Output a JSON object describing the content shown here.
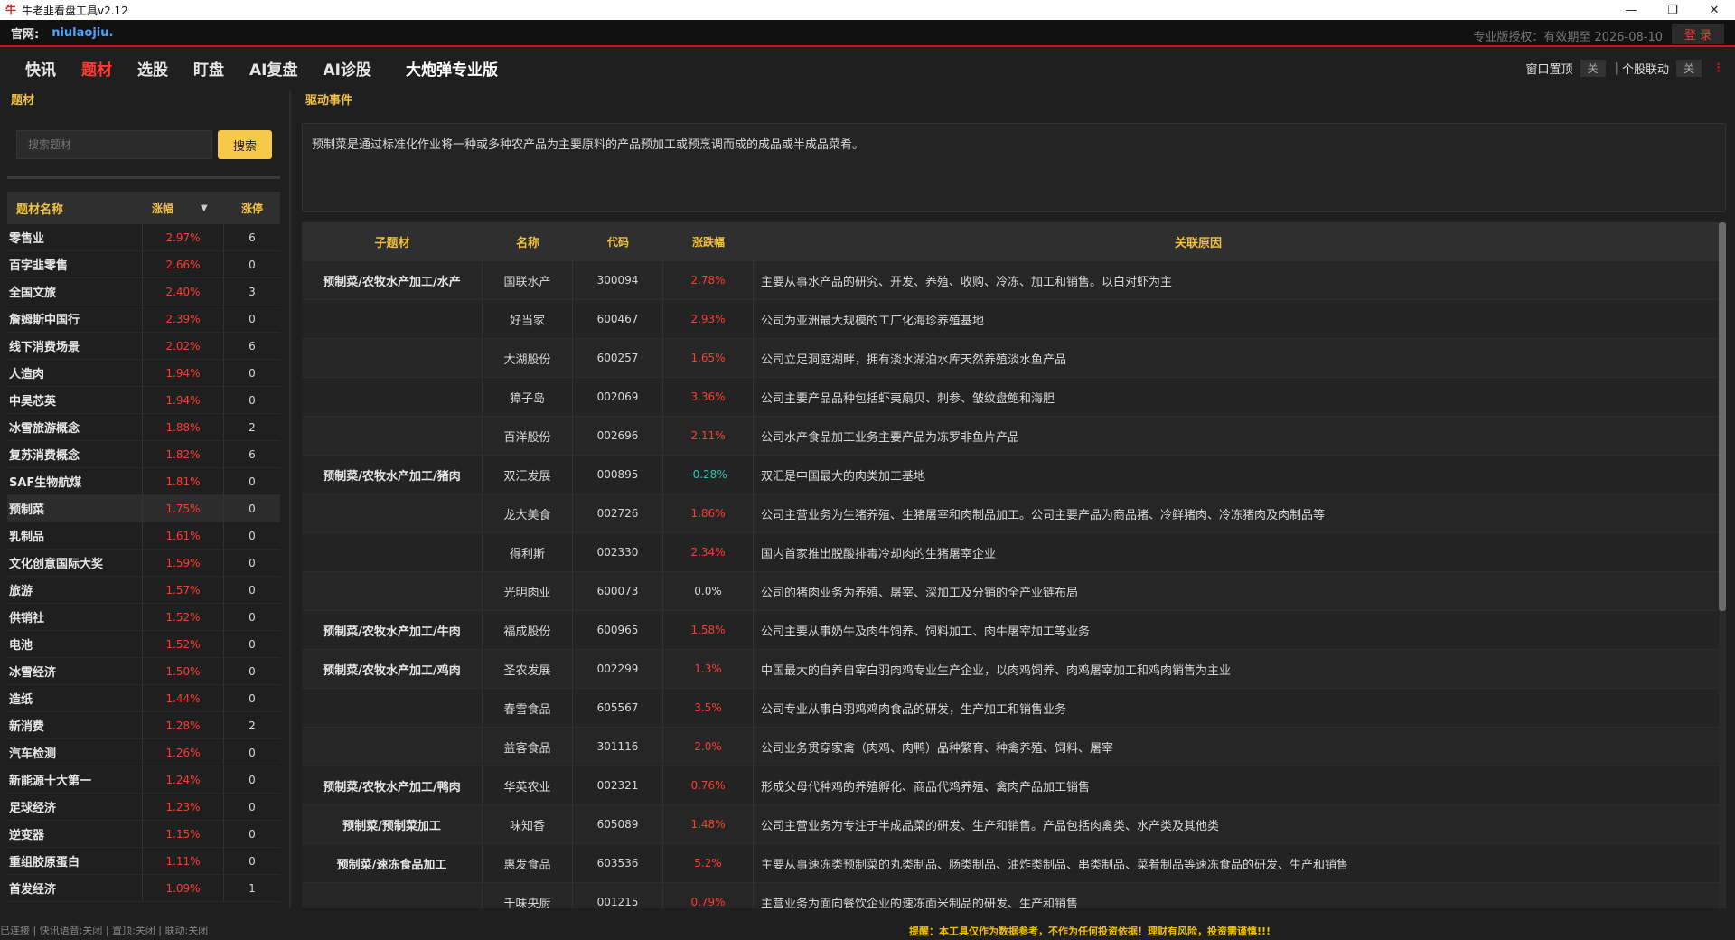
{
  "window": {
    "title": "牛老韭看盘工具v2.12",
    "logo_char": "牛",
    "minimize_label": "—",
    "restore_label": "❐",
    "close_label": "✕"
  },
  "site": {
    "label": "官网:",
    "link": "niulaojiu.",
    "license": "专业版授权：有效期至 2026-08-10",
    "login": "登 录"
  },
  "nav": {
    "items": [
      "快讯",
      "题材",
      "选股",
      "盯盘",
      "AI复盘",
      "AI诊股",
      "大炮弹专业版"
    ],
    "active": "题材",
    "right": {
      "pin_label": "窗口置顶",
      "pin_state": "关",
      "sep": "|",
      "link_label": "个股联动",
      "link_state": "关",
      "more_icon": "⋮"
    }
  },
  "left": {
    "title": "题材",
    "search_placeholder": "搜索题材",
    "search_button": "搜索",
    "headers": {
      "name": "题材名称",
      "change": "涨幅",
      "sort_icon": "▼",
      "limit": "涨停"
    },
    "rows": [
      {
        "name": "零售业",
        "change": "2.97%",
        "limit": "6"
      },
      {
        "name": "百字韭零售",
        "change": "2.66%",
        "limit": "0"
      },
      {
        "name": "全国文旅",
        "change": "2.40%",
        "limit": "3"
      },
      {
        "name": "詹姆斯中国行",
        "change": "2.39%",
        "limit": "0"
      },
      {
        "name": "线下消费场景",
        "change": "2.02%",
        "limit": "6"
      },
      {
        "name": "人造肉",
        "change": "1.94%",
        "limit": "0"
      },
      {
        "name": "中昊芯英",
        "change": "1.94%",
        "limit": "0"
      },
      {
        "name": "冰雪旅游概念",
        "change": "1.88%",
        "limit": "2"
      },
      {
        "name": "复苏消费概念",
        "change": "1.82%",
        "limit": "6"
      },
      {
        "name": "SAF生物航煤",
        "change": "1.81%",
        "limit": "0"
      },
      {
        "name": "预制菜",
        "change": "1.75%",
        "limit": "0"
      },
      {
        "name": "乳制品",
        "change": "1.61%",
        "limit": "0"
      },
      {
        "name": "文化创意国际大奖",
        "change": "1.59%",
        "limit": "0"
      },
      {
        "name": "旅游",
        "change": "1.57%",
        "limit": "0"
      },
      {
        "name": "供销社",
        "change": "1.52%",
        "limit": "0"
      },
      {
        "name": "电池",
        "change": "1.52%",
        "limit": "0"
      },
      {
        "name": "冰雪经济",
        "change": "1.50%",
        "limit": "0"
      },
      {
        "name": "造纸",
        "change": "1.44%",
        "limit": "0"
      },
      {
        "name": "新消费",
        "change": "1.28%",
        "limit": "2"
      },
      {
        "name": "汽车检测",
        "change": "1.26%",
        "limit": "0"
      },
      {
        "name": "新能源十大第一",
        "change": "1.24%",
        "limit": "0"
      },
      {
        "name": "足球经济",
        "change": "1.23%",
        "limit": "0"
      },
      {
        "name": "逆变器",
        "change": "1.15%",
        "limit": "0"
      },
      {
        "name": "重组胶原蛋白",
        "change": "1.11%",
        "limit": "0"
      },
      {
        "name": "首发经济",
        "change": "1.09%",
        "limit": "1"
      }
    ],
    "selected": "预制菜"
  },
  "right": {
    "title": "驱动事件",
    "description": "预制菜是通过标准化作业将一种或多种农产品为主要原料的产品预加工或预烹调而成的成品或半成品菜肴。",
    "headers": {
      "sub": "子题材",
      "name": "名称",
      "code": "代码",
      "change": "涨跌幅",
      "reason": "关联原因"
    },
    "rows": [
      {
        "sub": "预制菜/农牧水产加工/水产",
        "name": "国联水产",
        "code": "300094",
        "change": "2.78%",
        "reason": "主要从事水产品的研究、开发、养殖、收购、冷冻、加工和销售。以白对虾为主"
      },
      {
        "sub": "",
        "name": "好当家",
        "code": "600467",
        "change": "2.93%",
        "reason": "公司为亚洲最大规模的工厂化海珍养殖基地"
      },
      {
        "sub": "",
        "name": "大湖股份",
        "code": "600257",
        "change": "1.65%",
        "reason": "公司立足洞庭湖畔，拥有淡水湖泊水库天然养殖淡水鱼产品"
      },
      {
        "sub": "",
        "name": "獐子岛",
        "code": "002069",
        "change": "3.36%",
        "reason": "公司主要产品品种包括虾夷扇贝、刺参、皱纹盘鲍和海胆"
      },
      {
        "sub": "",
        "name": "百洋股份",
        "code": "002696",
        "change": "2.11%",
        "reason": "公司水产食品加工业务主要产品为冻罗非鱼片产品"
      },
      {
        "sub": "预制菜/农牧水产加工/猪肉",
        "name": "双汇发展",
        "code": "000895",
        "change": "-0.28%",
        "reason": "双汇是中国最大的肉类加工基地"
      },
      {
        "sub": "",
        "name": "龙大美食",
        "code": "002726",
        "change": "1.86%",
        "reason": "公司主营业务为生猪养殖、生猪屠宰和肉制品加工。公司主要产品为商品猪、冷鲜猪肉、冷冻猪肉及肉制品等"
      },
      {
        "sub": "",
        "name": "得利斯",
        "code": "002330",
        "change": "2.34%",
        "reason": "国内首家推出脱酸排毒冷却肉的生猪屠宰企业"
      },
      {
        "sub": "",
        "name": "光明肉业",
        "code": "600073",
        "change": "0.0%",
        "reason": "公司的猪肉业务为养殖、屠宰、深加工及分销的全产业链布局"
      },
      {
        "sub": "预制菜/农牧水产加工/牛肉",
        "name": "福成股份",
        "code": "600965",
        "change": "1.58%",
        "reason": "公司主要从事奶牛及肉牛饲养、饲料加工、肉牛屠宰加工等业务"
      },
      {
        "sub": "预制菜/农牧水产加工/鸡肉",
        "name": "圣农发展",
        "code": "002299",
        "change": "1.3%",
        "reason": "中国最大的自养自宰白羽肉鸡专业生产企业，以肉鸡饲养、肉鸡屠宰加工和鸡肉销售为主业"
      },
      {
        "sub": "",
        "name": "春雪食品",
        "code": "605567",
        "change": "3.5%",
        "reason": "公司专业从事白羽鸡鸡肉食品的研发，生产加工和销售业务"
      },
      {
        "sub": "",
        "name": "益客食品",
        "code": "301116",
        "change": "2.0%",
        "reason": "公司业务贯穿家禽（肉鸡、肉鸭）品种繁育、种禽养殖、饲料、屠宰"
      },
      {
        "sub": "预制菜/农牧水产加工/鸭肉",
        "name": "华英农业",
        "code": "002321",
        "change": "0.76%",
        "reason": "形成父母代种鸡的养殖孵化、商品代鸡养殖、禽肉产品加工销售"
      },
      {
        "sub": "预制菜/预制菜加工",
        "name": "味知香",
        "code": "605089",
        "change": "1.48%",
        "reason": "公司主营业务为专注于半成品菜的研发、生产和销售。产品包括肉禽类、水产类及其他类"
      },
      {
        "sub": "预制菜/速冻食品加工",
        "name": "惠发食品",
        "code": "603536",
        "change": "5.2%",
        "reason": "主要从事速冻类预制菜的丸类制品、肠类制品、油炸类制品、串类制品、菜肴制品等速冻食品的研发、生产和销售"
      },
      {
        "sub": "",
        "name": "千味央厨",
        "code": "001215",
        "change": "0.79%",
        "reason": "主营业务为面向餐饮企业的速冻面米制品的研发、生产和销售"
      }
    ]
  },
  "status": {
    "left": "已连接 | 快讯语音:关闭 | 置顶:关闭 | 联动:关闭",
    "warning": "提醒：本工具仅作为数据参考，不作为任何投资依据！理财有风险，投资需谨慎!!!"
  },
  "colors": {
    "accent_red": "#ff3b30",
    "heading_gold": "#f0c040",
    "negative_teal": "#2ec4b6",
    "brand_red": "#c8141c"
  }
}
